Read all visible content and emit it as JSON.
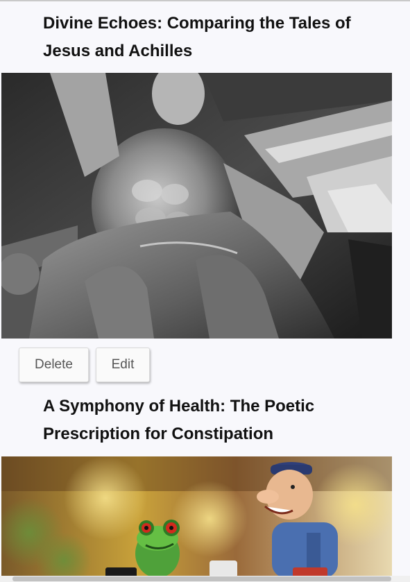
{
  "posts": [
    {
      "title": "Divine Echoes: Comparing the Tales of Jesus and Achilles",
      "image_subject": "marble-statue-of-muscular-figure",
      "actions": {
        "delete_label": "Delete",
        "edit_label": "Edit"
      }
    },
    {
      "title": "A Symphony of Health: The Poetic Prescription for Constipation",
      "image_subject": "frog-and-old-man-figurines"
    }
  ],
  "colors": {
    "page_background": "#f8f8fc",
    "title_text": "#111111",
    "button_text": "#555555",
    "button_background": "#fafafa"
  }
}
